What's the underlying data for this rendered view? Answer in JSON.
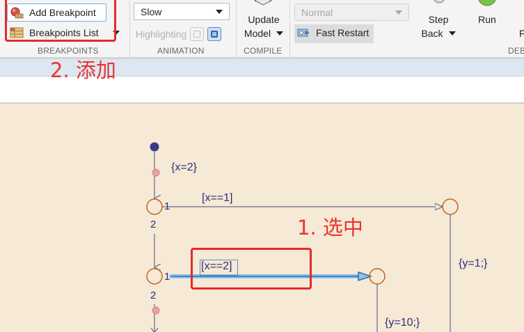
{
  "toolstrip": {
    "breakpoints": {
      "add_breakpoint": "Add Breakpoint",
      "breakpoints_list": "Breakpoints List",
      "section": "BREAKPOINTS"
    },
    "animation": {
      "speed": "Slow",
      "highlighting": "Highlighting",
      "section": "ANIMATION"
    },
    "compile": {
      "update_line1": "Update",
      "update_line2": "Model",
      "section": "COMPILE"
    },
    "simulate": {
      "mode": "Normal",
      "fast_restart": "Fast Restart"
    },
    "step_back": {
      "line1": "Step",
      "line2": "Back"
    },
    "run": "Run",
    "cutoff_right": "F",
    "cutoff_section": "DEB"
  },
  "annotations": {
    "add_step": "2. 添加",
    "select_step": "1. 选中"
  },
  "diagram": {
    "actions": {
      "x_eq_2_action": "{x=2}",
      "y_1_action": "{y=1;}",
      "y_10_action": "{y=10;}"
    },
    "conditions": {
      "x_eq_1": "[x==1]",
      "x_eq_2": "[x==2]"
    },
    "priorities": {
      "j1_right": "1",
      "j1_down": "2",
      "j2_right": "1",
      "j2_down": "2"
    }
  },
  "colors": {
    "annotation_red": "#e32b2b",
    "canvas_bg": "#f6e9d6",
    "junction_orange": "#c0651d",
    "selected_blue": "#3a9ad9",
    "variable_navy": "#2d2d7c",
    "value_purple": "#a034a0"
  }
}
